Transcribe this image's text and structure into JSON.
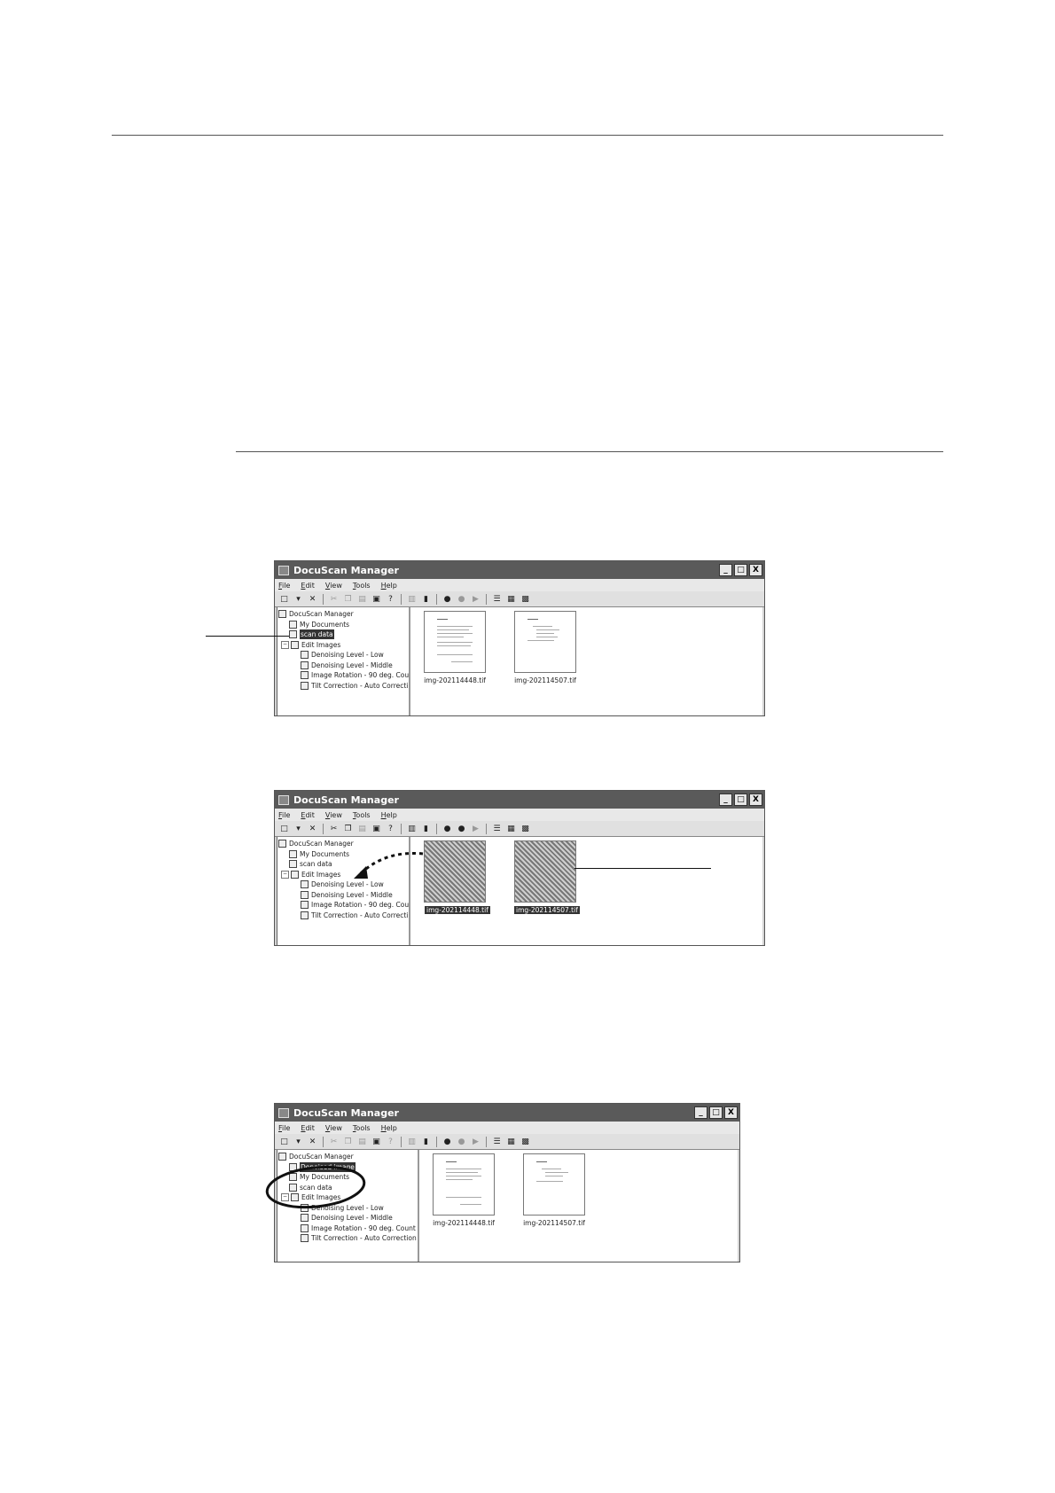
{
  "app": {
    "title": "DocuScan Manager",
    "window_buttons": [
      "_",
      "□",
      "X"
    ],
    "menus": [
      "File",
      "Edit",
      "View",
      "Tools",
      "Help"
    ]
  },
  "tree_a": {
    "root": "DocuScan Manager",
    "my_documents": "My Documents",
    "scan_data": "scan data",
    "edit_images": "Edit Images",
    "denoise_low": "Denoising Level - Low",
    "denoise_mid": "Denoising Level - Middle",
    "rotation": "Image Rotation - 90 deg. Cou",
    "tilt": "Tilt Correction - Auto Correcti"
  },
  "tree_b": {
    "root": "DocuScan Manager",
    "denoised": "Denoised image",
    "my_documents": "My Documents",
    "scan_data": "scan data",
    "edit_images": "Edit Images",
    "denoise_low": "Denoising Level - Low",
    "denoise_mid": "Denoising Level - Middle",
    "rotation": "Image Rotation - 90 deg. Count",
    "tilt": "Tilt Correction - Auto Correction"
  },
  "files": {
    "file1": "img-202114448.tif",
    "file2": "img-202114507.tif"
  }
}
